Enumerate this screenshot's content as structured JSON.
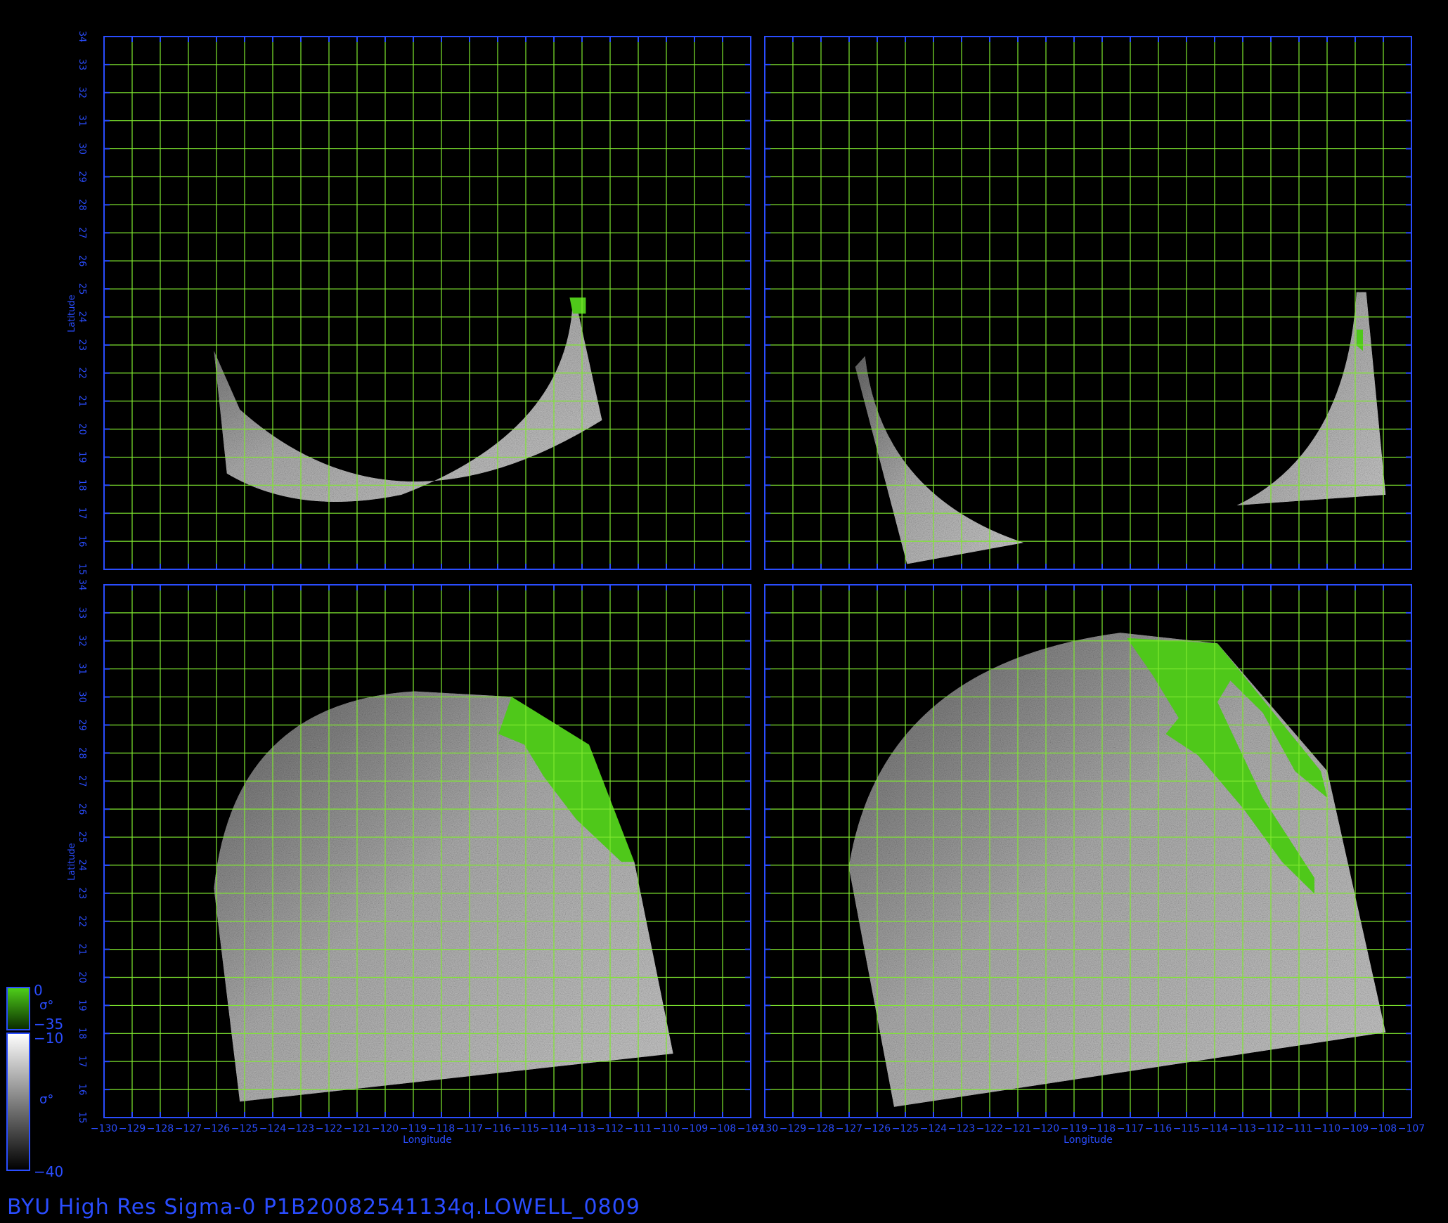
{
  "colors": {
    "background": "#000000",
    "axis": "#2a4dff",
    "grid": "#7fe830",
    "land": "#4fc81a",
    "swath_light": "#c8c8c8",
    "swath_dark": "#5a5a5a"
  },
  "axes": {
    "longitude_label": "Longitude",
    "latitude_label": "Latitude",
    "lon_ticks": [
      "−130",
      "−129",
      "−128",
      "−127",
      "−126",
      "−125",
      "−124",
      "−123",
      "−122",
      "−121",
      "−120",
      "−119",
      "−118",
      "−117",
      "−116",
      "−115",
      "−114",
      "−113",
      "−112",
      "−111",
      "−110",
      "−109",
      "−108",
      "−107"
    ],
    "lat_ticks": [
      "15",
      "16",
      "17",
      "18",
      "19",
      "20",
      "21",
      "22",
      "23",
      "24",
      "25",
      "26",
      "27",
      "28",
      "29",
      "30",
      "31",
      "32",
      "33",
      "34"
    ],
    "lon_range": [
      -130,
      -107
    ],
    "lat_range": [
      15,
      34
    ]
  },
  "panels": [
    {
      "id": "top-left",
      "swath": "crescent-wide"
    },
    {
      "id": "top-right",
      "swath": "two-arms"
    },
    {
      "id": "bottom-left",
      "swath": "disc-small"
    },
    {
      "id": "bottom-right",
      "swath": "disc-large"
    }
  ],
  "colorbar_land": {
    "top": "0",
    "bottom": "−35",
    "symbol": "σ°"
  },
  "colorbar_ocean": {
    "top": "−10",
    "bottom": "−40",
    "symbol": "σ°"
  },
  "footer": {
    "text": "BYU  High  Res  Sigma-0  P1B20082541134q.LOWELL_0809"
  }
}
